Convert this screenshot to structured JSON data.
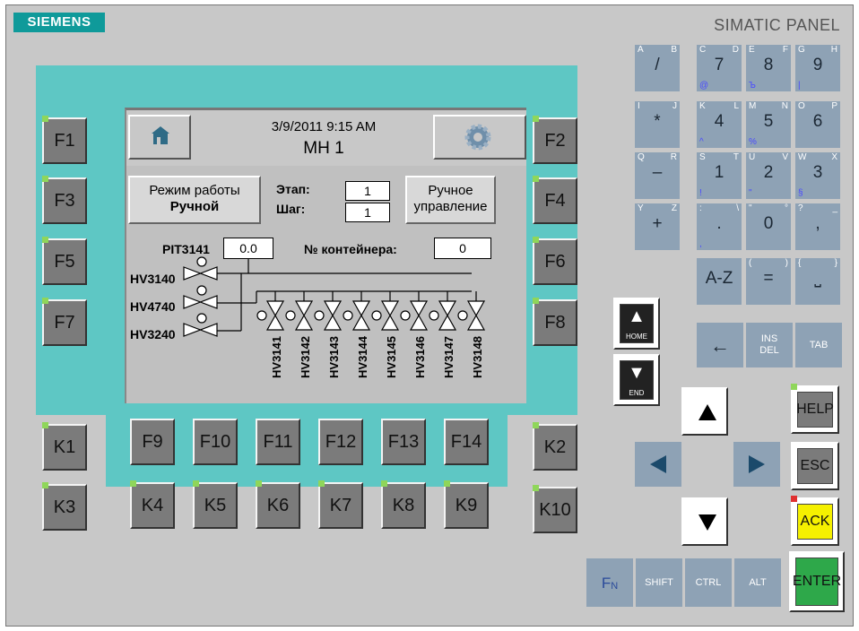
{
  "brand": {
    "logo": "SIEMENS",
    "model": "SIMATIC PANEL"
  },
  "screen": {
    "date": "3/9/2011 9:15 AM",
    "title": "MH 1",
    "mode_btn_line1": "Режим работы",
    "mode_btn_line2": "Ручной",
    "stage_label": "Этап:",
    "stage_value": "1",
    "step_label": "Шаг:",
    "step_value": "1",
    "manual_btn_line1": "Ручное",
    "manual_btn_line2": "управление",
    "pit_label": "PIT3141",
    "pit_value": "0.0",
    "container_label": "№ контейнера:",
    "container_value": "0",
    "valves_left": [
      "HV3140",
      "HV4740",
      "HV3240"
    ],
    "valves_bottom": [
      "HV3141",
      "HV3142",
      "HV3143",
      "HV3144",
      "HV3145",
      "HV3146",
      "HV3147",
      "HV3148"
    ]
  },
  "fkeys": {
    "F1": "F1",
    "F2": "F2",
    "F3": "F3",
    "F4": "F4",
    "F5": "F5",
    "F6": "F6",
    "F7": "F7",
    "F8": "F8",
    "F9": "F9",
    "F10": "F10",
    "F11": "F11",
    "F12": "F12",
    "F13": "F13",
    "F14": "F14"
  },
  "kkeys": {
    "K1": "K1",
    "K2": "K2",
    "K3": "K3",
    "K4": "K4",
    "K5": "K5",
    "K6": "K6",
    "K7": "K7",
    "K8": "K8",
    "K9": "K9",
    "K10": "K10"
  },
  "keypad": [
    {
      "tl": "A",
      "tr": "B",
      "c": "/",
      "bl": ""
    },
    {
      "tl": "C",
      "tr": "D",
      "c": "7",
      "bl": "@"
    },
    {
      "tl": "E",
      "tr": "F",
      "c": "8",
      "bl": "Ъ"
    },
    {
      "tl": "G",
      "tr": "H",
      "c": "9",
      "bl": "|"
    },
    {
      "tl": "I",
      "tr": "J",
      "c": "*",
      "bl": ""
    },
    {
      "tl": "K",
      "tr": "L",
      "c": "4",
      "bl": "^"
    },
    {
      "tl": "M",
      "tr": "N",
      "c": "5",
      "bl": "%"
    },
    {
      "tl": "O",
      "tr": "P",
      "c": "6",
      "bl": ""
    },
    {
      "tl": "Q",
      "tr": "R",
      "c": "–",
      "bl": ""
    },
    {
      "tl": "S",
      "tr": "T",
      "c": "1",
      "bl": "!"
    },
    {
      "tl": "U",
      "tr": "V",
      "c": "2",
      "bl": "\""
    },
    {
      "tl": "W",
      "tr": "X",
      "c": "3",
      "bl": "§"
    },
    {
      "tl": "Y",
      "tr": "Z",
      "c": "+",
      "bl": ""
    },
    {
      "tl": ":",
      "tr": "\\",
      "c": ".",
      "bl": ","
    },
    {
      "tl": "\"",
      "tr": "°",
      "c": "0",
      "bl": ""
    },
    {
      "tl": "?",
      "tr": "_",
      "c": ",",
      "bl": ""
    },
    {
      "tl": "",
      "tr": "",
      "c": "A-Z",
      "bl": ""
    },
    {
      "tl": "(",
      "tr": ")",
      "c": "=",
      "bl": ""
    },
    {
      "tl": "{",
      "tr": "}",
      "c": "⎵",
      "bl": ""
    }
  ],
  "nav": {
    "home": "HOME",
    "end": "END",
    "insdel_1": "INS",
    "insdel_2": "DEL",
    "tab": "TAB",
    "help": "HELP",
    "esc": "ESC",
    "ack": "ACK",
    "enter": "ENTER",
    "fn": "F",
    "fn_sub": "N",
    "shift": "SHIFT",
    "ctrl": "CTRL",
    "alt": "ALT"
  },
  "colors": {
    "teal": "#5ec7c4",
    "key_blue": "#8ea2b5",
    "ack": "#f5f000",
    "enter": "#2ea84a"
  }
}
